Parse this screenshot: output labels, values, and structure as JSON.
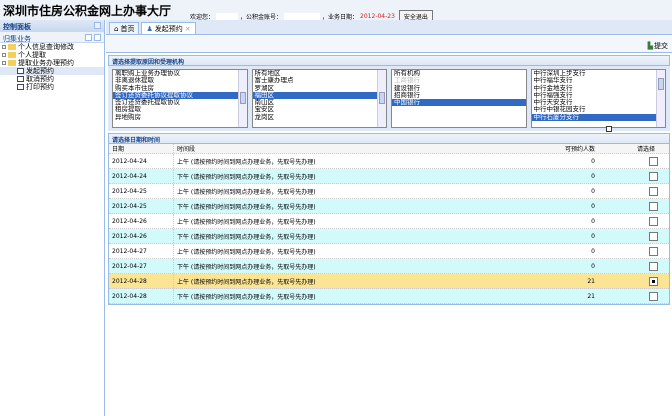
{
  "header": {
    "title": "深圳市住房公积金网上办事大厅",
    "welcome_label": "欢迎您：",
    "account_label": "，公积金账号：",
    "bizdate_label": "，业务日期：",
    "bizdate": "2012-04-23",
    "logout_label": "安全退出"
  },
  "sidebar": {
    "title": "控制面板",
    "group": "归集业务",
    "nodes": [
      {
        "label": "个人信息查询修改",
        "children": []
      },
      {
        "label": "个人提取",
        "children": []
      },
      {
        "label": "提取业务办理预约",
        "children": [
          {
            "label": "发起预约",
            "selected": true
          },
          {
            "label": "取消预约"
          },
          {
            "label": "打印预约"
          }
        ]
      }
    ]
  },
  "tabs": [
    {
      "label": "首页"
    },
    {
      "label": "发起预约",
      "active": true
    }
  ],
  "toolbar": {
    "submit_label": "提交"
  },
  "section1": {
    "title": "请选择提取原因和受理机构"
  },
  "lists": [
    {
      "items": [
        "离职购上业务办理协议",
        "非离退休提取",
        "购买本市住房",
        "签订还贷委托协议提取协议",
        "签订还贷委托提取协议",
        "租房提取",
        "异地购房"
      ],
      "selected": 3
    },
    {
      "items": [
        "所有地区",
        "富士康办理点",
        "罗湖区",
        "福田区",
        "南山区",
        "宝安区",
        "龙岗区"
      ],
      "selected": 3
    },
    {
      "items": [
        "所有机构",
        "工商银行",
        "建设银行",
        "招商银行",
        "中国银行"
      ],
      "selected": 4,
      "disabled": [
        1
      ]
    },
    {
      "items": [
        "中行深圳上步支行",
        "中行福华支行",
        "中行金地支行",
        "中行福强支行",
        "中行天安支行",
        "中行中银花园支行",
        "中行石厦分支行"
      ],
      "selected": 6
    }
  ],
  "section2": {
    "title": "请选择日期和时间"
  },
  "table": {
    "headers": [
      "日期",
      "时间段",
      "可预约人数",
      "请选择"
    ],
    "rows": [
      {
        "date": "2012-04-24",
        "slot": "上午 (请按预约时间到网点办理业务，先取号先办理)",
        "count": "0"
      },
      {
        "date": "2012-04-24",
        "slot": "下午 (请按预约时间到网点办理业务，先取号先办理)",
        "count": "0"
      },
      {
        "date": "2012-04-25",
        "slot": "上午 (请按预约时间到网点办理业务，先取号先办理)",
        "count": "0"
      },
      {
        "date": "2012-04-25",
        "slot": "下午 (请按预约时间到网点办理业务，先取号先办理)",
        "count": "0"
      },
      {
        "date": "2012-04-26",
        "slot": "上午 (请按预约时间到网点办理业务，先取号先办理)",
        "count": "0"
      },
      {
        "date": "2012-04-26",
        "slot": "下午 (请按预约时间到网点办理业务，先取号先办理)",
        "count": "0"
      },
      {
        "date": "2012-04-27",
        "slot": "上午 (请按预约时间到网点办理业务，先取号先办理)",
        "count": "0"
      },
      {
        "date": "2012-04-27",
        "slot": "下午 (请按预约时间到网点办理业务，先取号先办理)",
        "count": "0"
      },
      {
        "date": "2012-04-28",
        "slot": "上午 (请按预约时间到网点办理业务，先取号先办理)",
        "count": "21",
        "selected": true
      },
      {
        "date": "2012-04-28",
        "slot": "下午 (请按预约时间到网点办理业务，先取号先办理)",
        "count": "21"
      }
    ]
  }
}
